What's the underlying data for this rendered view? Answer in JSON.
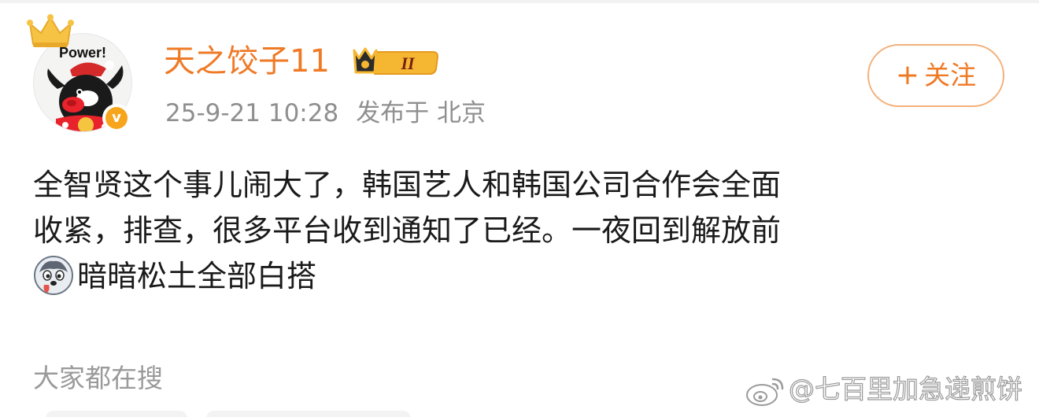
{
  "user": {
    "name": "天之饺子11",
    "avatar_text": "Power!",
    "verified_mark": "v",
    "level_badge_text": "II"
  },
  "meta": {
    "timestamp": "25-9-21 10:28",
    "location": "发布于 北京"
  },
  "follow_button": {
    "label": "关注",
    "icon": "plus-icon"
  },
  "post": {
    "lines": [
      "全智贤这个事儿闹大了，韩国艺人和韩国公司合作会全面",
      "收紧，排查，很多平台收到通知了已经。一夜回到解放前",
      "暗暗松土全部白搭"
    ],
    "emoji": "husky-emoji-icon"
  },
  "search_section": {
    "label": "大家都在搜"
  },
  "watermark": {
    "text": "@七百里加急递煎饼",
    "icon": "weibo-logo-icon"
  },
  "colors": {
    "accent": "#ef7a26",
    "follow_border": "#f3b07a",
    "meta_text": "#8f8f8f",
    "body_text": "#1a1a1a",
    "verified": "#f7a51c",
    "level_badge": "#f5b731"
  }
}
